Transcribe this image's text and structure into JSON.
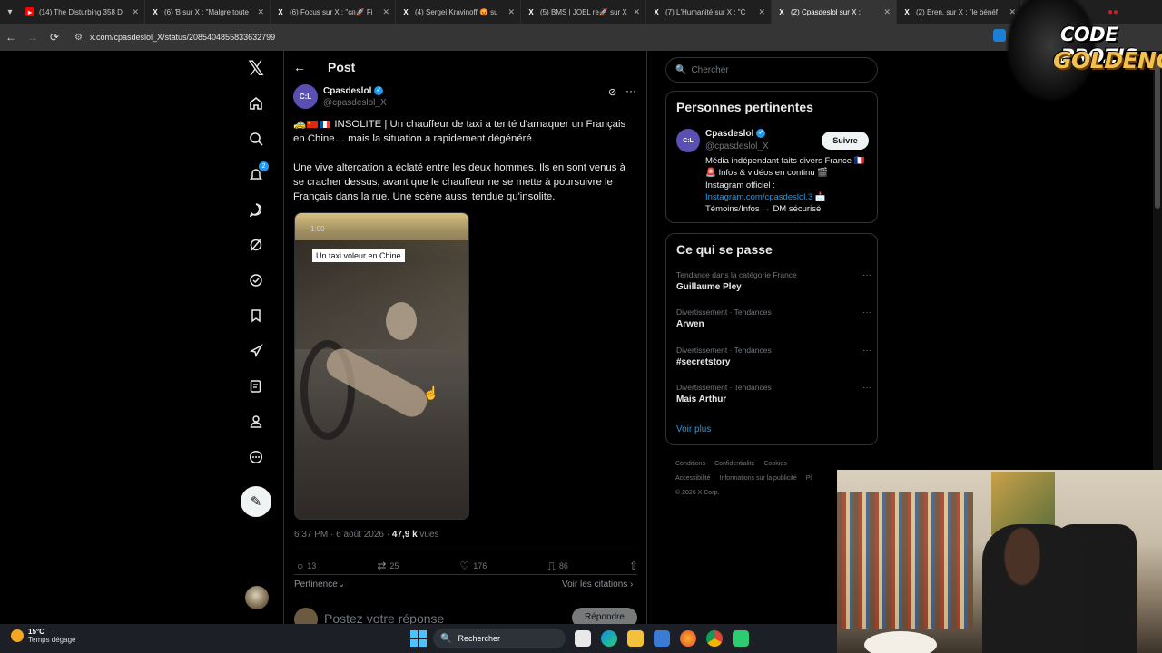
{
  "browser": {
    "tabs": [
      {
        "icon": "youtube-icon",
        "title": "(14) The Disturbing 358 D",
        "active": false
      },
      {
        "icon": "x-icon",
        "title": "(6) Ɓ sur X : \"Malgre toute",
        "active": false
      },
      {
        "icon": "x-icon",
        "title": "(6) Focus sur X : \"c̶n🚀 Fi",
        "active": false
      },
      {
        "icon": "x-icon",
        "title": "(4) Sergei Kravinoff 😡 su",
        "active": false
      },
      {
        "icon": "x-icon",
        "title": "(5) BMS | JOEL re🚀 sur X",
        "active": false
      },
      {
        "icon": "x-icon",
        "title": "(7) L'Humanité sur X : \"C",
        "active": false
      },
      {
        "icon": "x-icon",
        "title": "(2) Cpasdeslol sur X :",
        "active": true
      },
      {
        "icon": "x-icon",
        "title": "(2) Eren. sur X : \"le bénéf",
        "active": false
      }
    ],
    "url": "x.com/cpasdeslol_X/status/2085404855833632799"
  },
  "nav": {
    "items": [
      "home-icon",
      "search-icon",
      "notifications-icon",
      "messages-icon",
      "grok-icon",
      "verified-icon",
      "bookmarks-icon",
      "premium-rocket-icon",
      "articles-icon",
      "profile-icon",
      "more-icon"
    ],
    "notification_count": "2"
  },
  "main": {
    "header_title": "Post",
    "author_name": "Cpasdeslol",
    "author_handle": "@cpasdeslol_X",
    "text_lead": "INSOLITE | Un chauffeur de taxi a tenté d'arnaquer un Français en Chine… mais la situation a rapidement dégénéré.",
    "text_body": "Une vive altercation a éclaté entre les deux hommes. Ils en sont venus à se cracher dessus, avant que le chauffeur ne se mette à poursuivre le Français dans la rue. Une scène aussi tendue qu'insolite.",
    "video_timer": "1:00",
    "video_caption": "Un taxi  voleur en Chine",
    "meta_time": "6:37 PM · 6 août 2026 · ",
    "meta_views_count": "47,9 k",
    "meta_views_label": " vues",
    "replies": "13",
    "reposts": "25",
    "likes": "176",
    "bookmarks": "86",
    "sort_label": "Pertinence",
    "citations_label": "Voir les citations",
    "reply_placeholder": "Postez votre réponse",
    "reply_button": "Répondre"
  },
  "sidebar": {
    "search_placeholder": "Chercher",
    "relevant_title": "Personnes pertinentes",
    "person": {
      "name": "Cpasdeslol",
      "handle": "@cpasdeslol_X",
      "follow_label": "Suivre",
      "bio_line1": "Média indépendant faits divers France 🇫🇷 🚨 Infos & vidéos en continu 🎬",
      "bio_line2": "Instagram officiel :",
      "bio_link": "Instagram.com/cpasdeslol.3",
      "bio_line3": " 📩",
      "bio_line4": "Témoins/Infos → DM sécurisé"
    },
    "trends_title": "Ce qui se passe",
    "trends": [
      {
        "context": "Tendance dans la catégorie France",
        "name": "Guillaume Pley"
      },
      {
        "context": "Divertissement · Tendances",
        "name": "Arwen"
      },
      {
        "context": "Divertissement · Tendances",
        "name": "#secretstory"
      },
      {
        "context": "Divertissement · Tendances",
        "name": "Mais Arthur"
      }
    ],
    "see_more": "Voir plus",
    "footer": [
      "Conditions",
      "Confidentialité",
      "Cookies",
      "Accessibilité",
      "Informations sur la publicité",
      "Pl",
      "© 2026 X Corp."
    ]
  },
  "overlay": {
    "logo_line1": "CODE PROZIS",
    "logo_line2": "GOLDENG"
  },
  "taskbar": {
    "temp": "15°C",
    "weather": "Temps dégagé",
    "search_label": "Rechercher"
  },
  "colors": {
    "accent": "#1d9bf0",
    "background": "#000000",
    "border": "#2f3336",
    "muted": "#71767b"
  }
}
